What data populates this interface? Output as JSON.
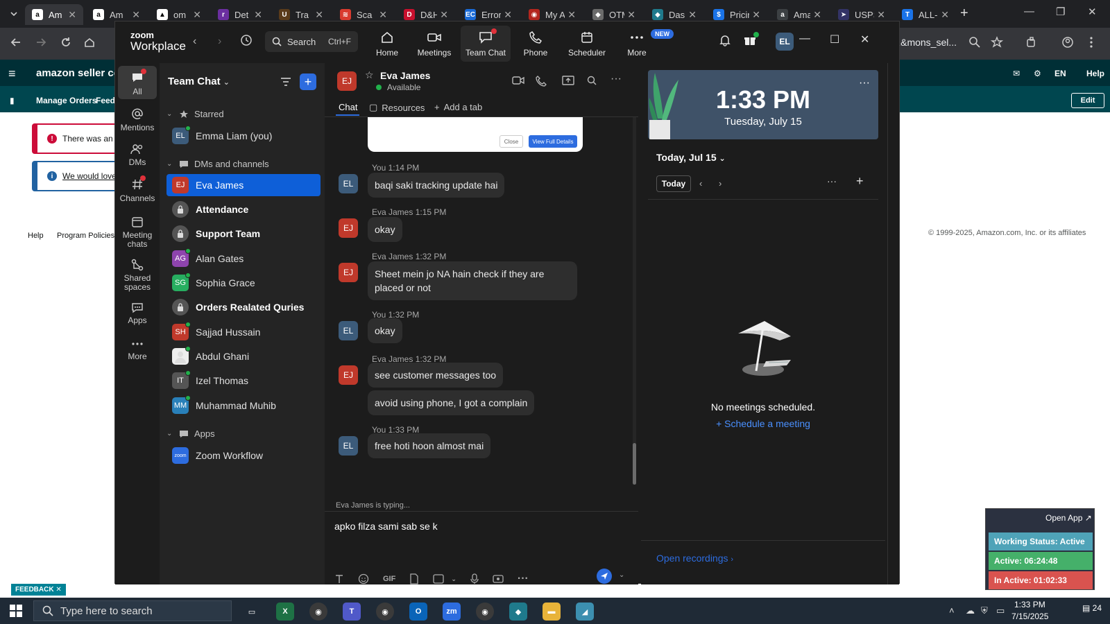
{
  "browser": {
    "tabs": [
      {
        "label": "Am",
        "fav_color": "#ffffff",
        "fav_text": "a",
        "active": true
      },
      {
        "label": "Am",
        "fav_color": "#ffffff",
        "fav_text": "a"
      },
      {
        "label": "om",
        "fav_color": "#ffffff",
        "fav_text": "▲"
      },
      {
        "label": "Det",
        "fav_color": "#6b2fa0",
        "fav_text": "r"
      },
      {
        "label": "Tra",
        "fav_color": "#5a3b1a",
        "fav_text": "U"
      },
      {
        "label": "Sca",
        "fav_color": "#d93b2f",
        "fav_text": "≋"
      },
      {
        "label": "D&H D",
        "fav_color": "#c8102e",
        "fav_text": "D"
      },
      {
        "label": "Error- E",
        "fav_color": "#1a6bd8",
        "fav_text": "EC"
      },
      {
        "label": "My Acc",
        "fav_color": "#b3261e",
        "fav_text": "◉"
      },
      {
        "label": "OTMS",
        "fav_color": "#6b6b6b",
        "fav_text": "◆"
      },
      {
        "label": "Dashbo",
        "fav_color": "#1f7a8c",
        "fav_text": "◆"
      },
      {
        "label": "Pricing",
        "fav_color": "#1a73e8",
        "fav_text": "$"
      },
      {
        "label": "Amazo",
        "fav_color": "#3c4043",
        "fav_text": "a"
      },
      {
        "label": "USPS.co",
        "fav_color": "#333366",
        "fav_text": "➤"
      },
      {
        "label": "ALL-IN-",
        "fav_color": "#1a73e8",
        "fav_text": "T"
      }
    ],
    "address_fragment": "R&mons_sel..."
  },
  "amazon": {
    "logo": "amazon seller cent",
    "sub_items": [
      "Manage Orders",
      "Feedb"
    ],
    "lang": "EN",
    "help": "Help",
    "edit": "Edit",
    "alert_error": "There was an e",
    "alert_info": "We would love",
    "footer_help": "Help",
    "footer_policies": "Program Policies",
    "copyright": "© 1999-2025, Amazon.com, Inc. or its affiliates",
    "feedback": "FEEDBACK"
  },
  "zoom": {
    "brand_line1": "zoom",
    "brand_line2": "Workplace",
    "search_label": "Search",
    "search_shortcut": "Ctrl+F",
    "nav": [
      {
        "label": "Home",
        "icon": "home-icon"
      },
      {
        "label": "Meetings",
        "icon": "video-icon"
      },
      {
        "label": "Team Chat",
        "icon": "chat-icon",
        "active": true
      },
      {
        "label": "Phone",
        "icon": "phone-icon"
      },
      {
        "label": "Scheduler",
        "icon": "calendar-icon"
      },
      {
        "label": "More",
        "icon": "more-icon"
      }
    ],
    "new_badge": "NEW",
    "user_initials": "EL",
    "rail": [
      {
        "label": "All",
        "icon": "chat-icon",
        "active": true
      },
      {
        "label": "Mentions",
        "icon": "at-icon"
      },
      {
        "label": "DMs",
        "icon": "users-icon"
      },
      {
        "label": "Channels",
        "icon": "hash-icon"
      },
      {
        "label": "Meeting chats",
        "icon": "calendar-icon"
      },
      {
        "label": "Shared spaces",
        "icon": "share-icon"
      },
      {
        "label": "Apps",
        "icon": "apps-icon"
      },
      {
        "label": "More",
        "icon": "more-icon"
      }
    ],
    "side": {
      "title": "Team Chat",
      "starred_label": "Starred",
      "dm_label": "DMs and channels",
      "apps_label": "Apps",
      "starred": [
        {
          "initials": "EL",
          "name": "Emma Liam (you)",
          "color": "#3c5b7a",
          "presence": true
        }
      ],
      "items": [
        {
          "initials": "EJ",
          "name": "Eva James",
          "color": "#c0392b",
          "presence": false,
          "active": true
        },
        {
          "name": "Attendance",
          "lock": true,
          "bold": true
        },
        {
          "name": "Support Team",
          "lock": true,
          "bold": true
        },
        {
          "initials": "AG",
          "name": "Alan Gates",
          "color": "#8e44ad",
          "presence": true
        },
        {
          "initials": "SG",
          "name": "Sophia Grace",
          "color": "#27ae60",
          "presence": true
        },
        {
          "name": "Orders Realated Quries",
          "lock": true,
          "bold": true
        },
        {
          "initials": "SH",
          "name": "Sajjad Hussain",
          "color": "#c0392b",
          "presence": true
        },
        {
          "initials": "AB",
          "name": "Abdul Ghani",
          "color": "#7f8c8d",
          "presence": true,
          "photo": true
        },
        {
          "initials": "IT",
          "name": "Izel Thomas",
          "color": "#555555",
          "presence": true
        },
        {
          "initials": "MM",
          "name": "Muhammad Muhib",
          "color": "#2980b9",
          "presence": true
        }
      ],
      "apps": [
        {
          "initials": "zoom",
          "name": "Zoom Workflow",
          "color": "#2d6cdf"
        }
      ]
    },
    "chat": {
      "contact": "Eva James",
      "contact_initials": "EJ",
      "status": "Available",
      "tabs": [
        "Chat",
        "Resources",
        "Add a tab"
      ],
      "card_close": "Close",
      "card_view": "View Full Details",
      "messages": [
        {
          "meta": "You 1:14 PM",
          "who": "EL",
          "color": "#3c5b7a",
          "bubbles": [
            "baqi saki tracking update hai"
          ]
        },
        {
          "meta": "Eva James 1:15 PM",
          "who": "EJ",
          "color": "#c0392b",
          "bubbles": [
            "okay"
          ]
        },
        {
          "meta": "Eva James 1:32 PM",
          "who": "EJ",
          "color": "#c0392b",
          "bubbles": [
            "Sheet mein jo NA hain check if they are placed or not"
          ]
        },
        {
          "meta": "You 1:32 PM",
          "who": "EL",
          "color": "#3c5b7a",
          "bubbles": [
            "okay"
          ]
        },
        {
          "meta": "Eva James 1:32 PM",
          "who": "EJ",
          "color": "#c0392b",
          "bubbles": [
            "see customer messages too",
            "avoid using phone, I got a complain"
          ]
        },
        {
          "meta": "You 1:33 PM",
          "who": "EL",
          "color": "#3c5b7a",
          "bubbles": [
            "free hoti hoon almost mai"
          ]
        }
      ],
      "typing": "Eva James  is typing...",
      "draft": "apko filza sami sab se k"
    },
    "calendar": {
      "time": "1:33 PM",
      "date": "Tuesday, July 15",
      "day_label": "Today, Jul 15",
      "today_btn": "Today",
      "empty": "No meetings scheduled.",
      "schedule": "Schedule a meeting",
      "recordings": "Open recordings"
    }
  },
  "widget": {
    "open_app": "Open App",
    "status": "Working Status: Active",
    "active": "Active: 06:24:48",
    "inactive": "In Active: 01:02:33",
    "colors": {
      "status": "#4fa3b8",
      "active": "#45b06a",
      "inactive": "#d9534f"
    }
  },
  "taskbar": {
    "search_placeholder": "Type here to search",
    "time": "1:33 PM",
    "date": "7/15/2025",
    "notif_count": "24"
  }
}
